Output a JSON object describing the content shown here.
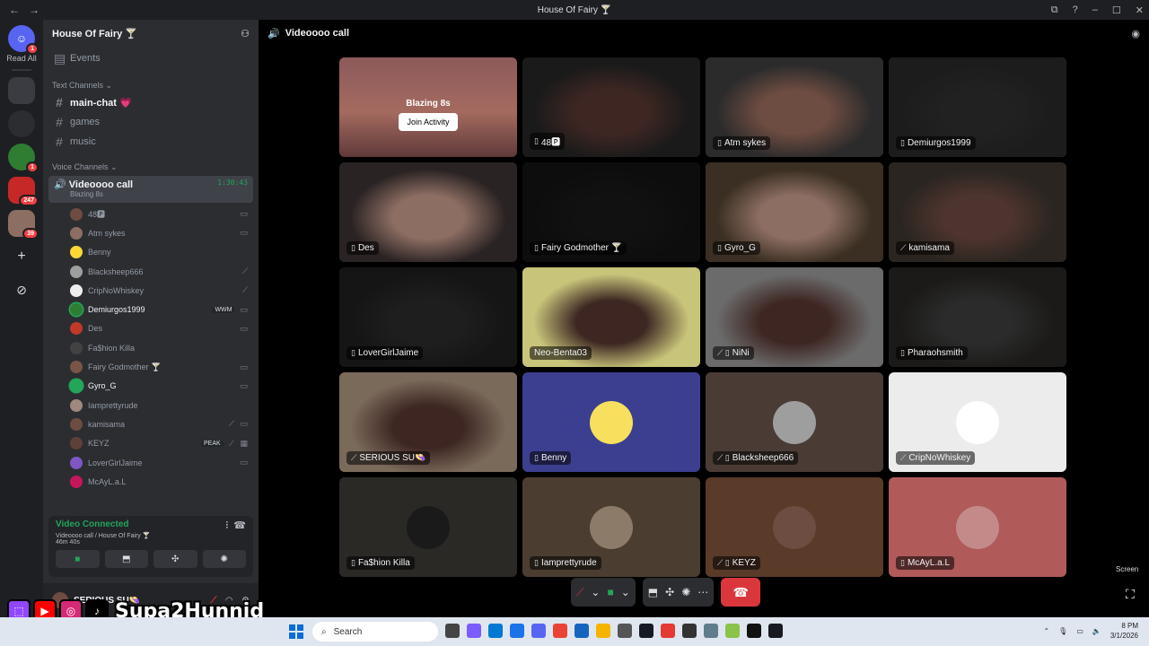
{
  "window": {
    "title": "House Of Fairy 🍸"
  },
  "rail": {
    "readall": "Read All",
    "servers": [
      {
        "badge": "1",
        "color": "#5865f2"
      },
      {
        "badge": "",
        "color": "#3a3c42"
      },
      {
        "badge": "",
        "color": "#2b2d31"
      },
      {
        "badge": "1",
        "color": "#2e7d32"
      },
      {
        "badge": "247",
        "color": "#c62828"
      },
      {
        "badge": "39",
        "color": "#8d6e63"
      }
    ]
  },
  "sidebar": {
    "server_name": "House Of Fairy 🍸",
    "events_label": "Events",
    "text_category": "Text Channels",
    "text_channels": [
      {
        "name": "main-chat 💗",
        "active": true
      },
      {
        "name": "games",
        "active": false
      },
      {
        "name": "music",
        "active": false
      }
    ],
    "voice_category": "Voice Channels",
    "voice_channel": {
      "name": "Videoooo call",
      "timer": "1:30:43",
      "activity": "Blazing 8s"
    },
    "members": [
      {
        "name": "48🅿",
        "icons": "▭",
        "color": "#6d4c41",
        "tag": ""
      },
      {
        "name": "Atm sykes",
        "icons": "▭",
        "color": "#8d6e63",
        "tag": ""
      },
      {
        "name": "Benny",
        "icons": "",
        "color": "#fdd835",
        "tag": ""
      },
      {
        "name": "Blacksheep666",
        "icons": "⟋",
        "color": "#9e9e9e",
        "tag": ""
      },
      {
        "name": "CripNoWhiskey",
        "icons": "⟋",
        "color": "#eeeeee",
        "tag": ""
      },
      {
        "name": "Demiurgos1999",
        "icons": "▭",
        "color": "#2e7d32",
        "tag": "WWM",
        "speaking": true
      },
      {
        "name": "Des",
        "icons": "▭",
        "color": "#c0392b",
        "tag": ""
      },
      {
        "name": "Fa$hion Killa",
        "icons": "",
        "color": "#424242",
        "tag": ""
      },
      {
        "name": "Fairy Godmother 🍸",
        "icons": "▭",
        "color": "#795548",
        "tag": ""
      },
      {
        "name": "Gyro_G",
        "icons": "▭",
        "color": "#23a55a",
        "tag": "",
        "speaking": true
      },
      {
        "name": "Iamprettyrude",
        "icons": "",
        "color": "#a1887f",
        "tag": ""
      },
      {
        "name": "kamisama",
        "icons": "⟋ ▭",
        "color": "#6d4c41",
        "tag": ""
      },
      {
        "name": "KEYZ",
        "icons": "⟋ ▦",
        "color": "#5d4037",
        "tag": "PEAK"
      },
      {
        "name": "LoverGirlJaime",
        "icons": "▭",
        "color": "#7e57c2",
        "tag": ""
      },
      {
        "name": "McAyL.a.L",
        "icons": "",
        "color": "#c2185b",
        "tag": ""
      }
    ],
    "voice_panel": {
      "status": "Video Connected",
      "location": "Videoooo call / House Of Fairy 🍸",
      "duration": "46m 40s"
    },
    "user": {
      "name": "SERIOUS SU👒"
    }
  },
  "stage": {
    "channel_title": "Videoooo call",
    "activity": {
      "title": "Blazing 8s",
      "button": "Join Activity"
    },
    "tiles": [
      {
        "name": "activity",
        "label": "",
        "bg": "#7a4040",
        "kind": "activity"
      },
      {
        "name": "48🅿",
        "label": "48🅿",
        "bg": "#1a1a1a",
        "icon": "▯",
        "face": "#3e2723"
      },
      {
        "name": "Atm sykes",
        "label": "Atm sykes",
        "bg": "#2b2b2b",
        "icon": "▯",
        "face": "#6d4c41"
      },
      {
        "name": "Demiurgos1999",
        "label": "Demiurgos1999",
        "bg": "#1c1c1c",
        "icon": "▯",
        "face": "#212121",
        "speaking": true
      },
      {
        "name": "Des",
        "label": "Des",
        "bg": "#2a2323",
        "icon": "▯",
        "face": "#8d6e63"
      },
      {
        "name": "Fairy Godmother 🍸",
        "label": "Fairy Godmother 🍸",
        "bg": "#0d0d0d",
        "icon": "▯",
        "face": "#111111"
      },
      {
        "name": "Gyro_G",
        "label": "Gyro_G",
        "bg": "#3a2f22",
        "icon": "▯",
        "face": "#8d6e63",
        "speaking": true
      },
      {
        "name": "kamisama",
        "label": "kamisama",
        "bg": "#2a2520",
        "icon": "⟋",
        "face": "#4e342e"
      },
      {
        "name": "LoverGirlJaime",
        "label": "LoverGirlJaime",
        "bg": "#151515",
        "icon": "▯",
        "face": "#1e1e1e"
      },
      {
        "name": "Neo-Benta03",
        "label": "Neo-Benta03",
        "bg": "#c8c47a",
        "icon": "",
        "face": "#3e2723"
      },
      {
        "name": "NiNi",
        "label": "NiNi",
        "bg": "#6b6b6b",
        "icon": "⟋ ▯",
        "face": "#3e2723"
      },
      {
        "name": "Pharaohsmith",
        "label": "Pharaohsmith",
        "bg": "#1b1a18",
        "icon": "▯",
        "face": "#2b2b2b"
      },
      {
        "name": "SERIOUS SU👒",
        "label": "SERIOUS SU👒",
        "bg": "#7a6a5a",
        "icon": "⟋",
        "face": "#3e2723"
      },
      {
        "name": "Benny",
        "label": "Benny",
        "bg": "#3c3f8f",
        "icon": "▯",
        "avatar": "#f6e05e"
      },
      {
        "name": "Blacksheep666",
        "label": "Blacksheep666",
        "bg": "#4a3c35",
        "icon": "⟋ ▯",
        "avatar": "#9e9e9e"
      },
      {
        "name": "CripNoWhiskey",
        "label": "CripNoWhiskey",
        "bg": "#ececec",
        "icon": "⟋",
        "avatar": "#ffffff"
      },
      {
        "name": "Fa$hion Killa",
        "label": "Fa$hion Killa",
        "bg": "#2a2926",
        "icon": "▯",
        "avatar": "#1a1a1a"
      },
      {
        "name": "Iamprettyrude",
        "label": "Iamprettyrude",
        "bg": "#4b3d30",
        "icon": "▯",
        "avatar": "#8d7b6a"
      },
      {
        "name": "KEYZ",
        "label": "KEYZ",
        "bg": "#5a3a28",
        "icon": "⟋ ▯",
        "avatar": "#6d4c41"
      },
      {
        "name": "McAyL.a.L",
        "label": "McAyL.a.L",
        "bg": "#b05a5a",
        "icon": "▯",
        "avatar": "#c48a8a"
      }
    ],
    "screen_label": "Screen"
  },
  "overlay": {
    "handle": "Supa2Hunnid"
  },
  "taskbar": {
    "search_placeholder": "Search",
    "time": "8 PM",
    "date": "3/1/2026",
    "apps": [
      "#444",
      "#7b5cff",
      "#0078d4",
      "#1a73e8",
      "#5865f2",
      "#ea4335",
      "#1565c0",
      "#f5b400",
      "#555",
      "#171a21",
      "#e53935",
      "#333",
      "#607d8b",
      "#8bc34a",
      "#111",
      "#171a21"
    ]
  },
  "colors": {
    "speaking": "#23a55a",
    "danger": "#da373c",
    "blurple": "#5865f2"
  }
}
